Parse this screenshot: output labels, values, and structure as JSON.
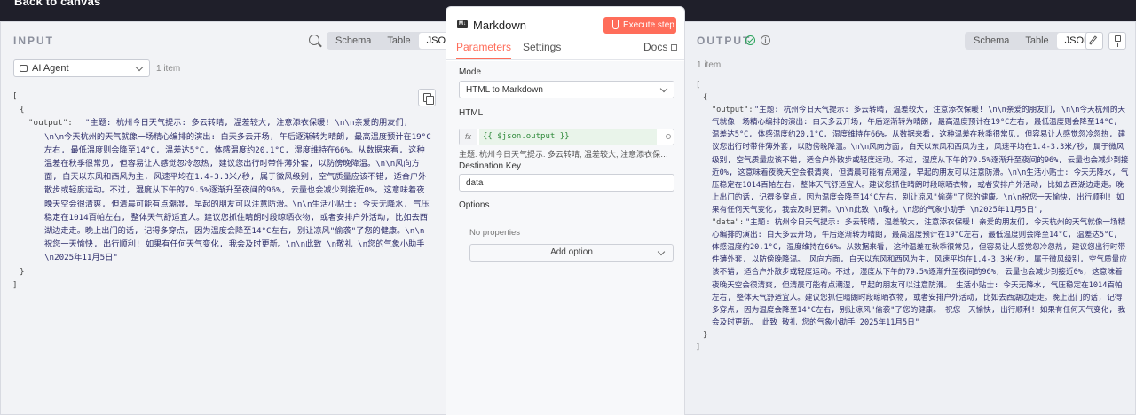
{
  "topbar": {
    "back_label": "Back to canvas"
  },
  "input": {
    "title": "INPUT",
    "tabs": [
      "Schema",
      "Table",
      "JSON"
    ],
    "active_tab": "JSON",
    "source_node": "AI Agent",
    "item_count": "1 item",
    "json": {
      "open_bracket": "[",
      "open_brace": "{",
      "key": "\"output\": ",
      "value": "\"主题: 杭州今日天气提示: 多云转晴, 温差较大, 注意添衣保暖! \\n\\n亲爱的朋友们, \\n\\n今天杭州的天气就像一场精心编排的演出: 白天多云开场, 午后逐渐转为晴朗, 最高温度预计在19°C左右, 最低温度则会降至14°C, 温差达5°C, 体感温度约20.1°C, 湿度维持在66%。从数据来看, 这种温差在秋季很常见, 但容易让人感觉忽冷忽热, 建议您出行时带件薄外套, 以防傍晚降温。\\n\\n风向方面, 白天以东风和西风为主, 风速平均在1.4-3.3米/秒, 属于微风级别, 空气质量应该不错, 适合户外散步或轻度运动。不过, 湿度从下午的79.5%逐渐升至夜间的96%, 云量也会减少到接近0%, 这意味着夜晚天空会很清爽, 但清晨可能有点潮湿, 早起的朋友可以注意防滑。\\n\\n生活小贴士: 今天无降水, 气压稳定在1014百帕左右, 整体天气舒适宜人。建议您抓住晴朗时段晾晒衣物, 或者安排户外活动, 比如去西湖边走走。晚上出门的话, 记得多穿点, 因为温度会降至14°C左右, 别让凉风\"偷袭\"了您的健康。\\n\\n祝您一天愉快, 出行顺利! 如果有任何天气变化, 我会及时更新。\\n\\n此致   \\n敬礼   \\n您的气象小助手   \\n2025年11月5日\"",
      "close_brace": "}",
      "close_bracket": "]"
    }
  },
  "node": {
    "icon_text": "M↓",
    "title": "Markdown",
    "execute_label": "Execute step",
    "tabs": {
      "parameters": "Parameters",
      "settings": "Settings",
      "docs": "Docs"
    },
    "mode_label": "Mode",
    "mode_value": "HTML to Markdown",
    "html_label": "HTML",
    "html_expression": "{{ $json.output }}",
    "html_preview": "主题: 杭州今日天气提示: 多云转晴, 温差较大, 注意添衣保暖...",
    "dest_label": "Destination Key",
    "dest_value": "data",
    "options_label": "Options",
    "no_props": "No properties",
    "add_option": "Add option"
  },
  "output": {
    "title": "OUTPUT",
    "tabs": [
      "Schema",
      "Table",
      "JSON"
    ],
    "active_tab": "JSON",
    "item_count": "1 item",
    "json": {
      "open_bracket": "[",
      "open_brace": "{",
      "output_key": "\"output\": ",
      "output_value": "\"主题: 杭州今日天气提示: 多云转晴, 温差较大, 注意添衣保暖! \\n\\n亲爱的朋友们, \\n\\n今天杭州的天气就像一场精心编排的演出: 白天多云开场, 午后逐渐转为晴朗, 最高温度预计在19°C左右, 最低温度则会降至14°C, 温差达5°C, 体感温度约20.1°C, 湿度维持在66%。从数据来看, 这种温差在秋季很常见, 但容易让人感觉忽冷忽热, 建议您出行时带件薄外套, 以防傍晚降温。\\n\\n风向方面, 白天以东风和西风为主, 风速平均在1.4-3.3米/秒, 属于微风级别, 空气质量应该不错, 适合户外散步或轻度运动。不过, 湿度从下午的79.5%逐渐升至夜间的96%, 云量也会减少到接近0%, 这意味着夜晚天空会很清爽, 但清晨可能有点潮湿, 早起的朋友可以注意防滑。\\n\\n生活小贴士: 今天无降水, 气压稳定在1014百帕左右, 整体天气舒适宜人。建议您抓住晴朗时段晾晒衣物, 或者安排户外活动, 比如去西湖边走走。晚上出门的话, 记得多穿点, 因为温度会降至14°C左右, 别让凉风\"偷袭\"了您的健康。\\n\\n祝您一天愉快, 出行顺利! 如果有任何天气变化, 我会及时更新。\\n\\n此致   \\n敬礼   \\n您的气象小助手   \\n2025年11月5日\",",
      "data_key": "\"data\": ",
      "data_value": "\"主题: 杭州今日天气提示: 多云转晴, 温差较大, 注意添衣保暖!  亲爱的朋友们,  今天杭州的天气就像一场精心编排的演出: 白天多云开场, 午后逐渐转为晴朗, 最高温度预计在19°C左右, 最低温度则会降至14°C, 温差达5°C, 体感温度约20.1°C, 湿度维持在66%。从数据来看, 这种温差在秋季很常见, 但容易让人感觉忽冷忽热, 建议您出行时带件薄外套, 以防傍晚降温。  风向方面, 白天以东风和西风为主, 风速平均在1.4-3.3米/秒, 属于微风级别, 空气质量应该不错, 适合户外散步或轻度运动。不过, 湿度从下午的79.5%逐渐升至夜间的96%, 云量也会减少到接近0%, 这意味着夜晚天空会很清爽, 但清晨可能有点潮湿, 早起的朋友可以注意防滑。  生活小贴士: 今天无降水, 气压稳定在1014百帕左右, 整体天气舒适宜人。建议您抓住晴朗时段晾晒衣物, 或者安排户外活动, 比如去西湖边走走。晚上出门的话, 记得多穿点, 因为温度会降至14°C左右, 别让凉风\"偷袭\"了您的健康。  祝您一天愉快, 出行顺利! 如果有任何天气变化, 我会及时更新。  此致 敬礼 您的气象小助手 2025年11月5日\"",
      "close_brace": "}",
      "close_bracket": "]"
    }
  }
}
